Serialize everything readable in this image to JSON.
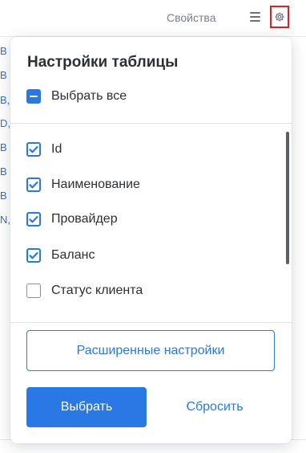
{
  "header": {
    "properties_label": "Свойства",
    "menu_icon": "hamburger-icon",
    "settings_icon": "gear-icon"
  },
  "background_rows": [
    "B",
    "B",
    "B,",
    "D,",
    "B",
    "B",
    "B",
    "N,"
  ],
  "popup": {
    "title": "Настройки таблицы",
    "select_all": {
      "label": "Выбрать все",
      "state": "indeterminate"
    },
    "columns": [
      {
        "label": "Id",
        "checked": true
      },
      {
        "label": "Наименование",
        "checked": true
      },
      {
        "label": "Провайдер",
        "checked": true
      },
      {
        "label": "Баланс",
        "checked": true
      },
      {
        "label": "Статус клиента",
        "checked": false
      }
    ],
    "advanced_settings_label": "Расширенные настройки",
    "select_label": "Выбрать",
    "reset_label": "Сбросить"
  },
  "colors": {
    "accent": "#2a78e4",
    "highlight_border": "#e02020",
    "text": "#2c2f36"
  }
}
